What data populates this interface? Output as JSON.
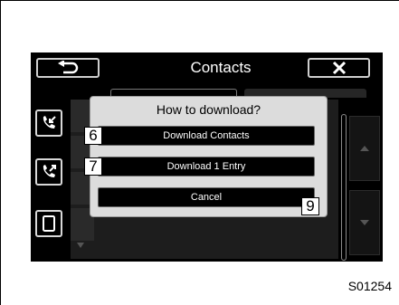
{
  "header": {
    "title": "Contacts"
  },
  "tabs": {
    "background_tab": "Download Contacts"
  },
  "dialog": {
    "title": "How to download?",
    "buttons": [
      {
        "label": "Download Contacts",
        "callout": "6"
      },
      {
        "label": "Download 1 Entry",
        "callout": "7"
      },
      {
        "label": "Cancel",
        "callout": "9"
      }
    ]
  },
  "icons": {
    "back": "return-arrow-icon",
    "close": "close-icon",
    "sidebar": [
      "incoming-call-icon",
      "outgoing-call-icon",
      "phone-device-icon"
    ]
  },
  "figure_code": "S01254"
}
